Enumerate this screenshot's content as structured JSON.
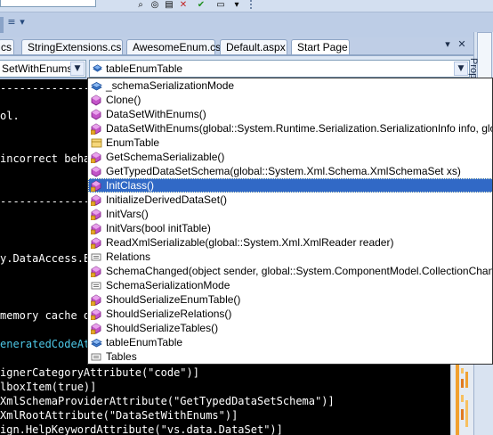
{
  "toolbar": {
    "icons": [
      "search-icon",
      "binoculars-icon",
      "properties-icon",
      "close-icon",
      "check-icon",
      "window-icon"
    ],
    "dropdown_glyph": "▾",
    "grip_glyph": "⁞"
  },
  "tabs": [
    {
      "label": "cs"
    },
    {
      "label": "StringExtensions.cs"
    },
    {
      "label": "AwesomeEnum.cs"
    },
    {
      "label": "Default.aspx"
    },
    {
      "label": "Start Page"
    }
  ],
  "tab_controls": {
    "dropdown": "▾",
    "close": "✕"
  },
  "navigation": {
    "type_combo_value": "SetWithEnums",
    "member_combo_value": "tableEnumTable",
    "arrow": "▼"
  },
  "side_panel": {
    "label": "Prop"
  },
  "code_lines": [
    {
      "text": "---------------",
      "color": "#ffffff"
    },
    {
      "text": "ol.",
      "color": "#ffffff"
    },
    {
      "text": "incorrect beha",
      "color": "#ffffff"
    },
    {
      "text": "---------------",
      "color": "#ffffff"
    },
    {
      "text": "y.DataAccess.E",
      "color": "#ffffff"
    },
    {
      "text": "memory cache o",
      "color": "#ffffff"
    },
    {
      "text": "eneratedCodeAt",
      "color": "#4ec9e8"
    },
    {
      "text": "ignerCategoryAttribute(\"code\")]",
      "color": "#ffffff"
    },
    {
      "text": "lboxItem(true)]",
      "color": "#ffffff"
    },
    {
      "text": "XmlSchemaProviderAttribute(\"GetTypedDataSetSchema\")]",
      "color": "#ffffff"
    },
    {
      "text": "XmlRootAttribute(\"DataSetWithEnums\")]",
      "color": "#ffffff"
    },
    {
      "text": "ign.HelpKeywordAttribute(\"vs.data.DataSet\")]",
      "color": "#ffffff"
    }
  ],
  "completion_list": {
    "selected_index": 7,
    "items": [
      {
        "label": "_schemaSerializationMode",
        "icon": "field-icon"
      },
      {
        "label": "Clone()",
        "icon": "method-icon"
      },
      {
        "label": "DataSetWithEnums()",
        "icon": "method-icon"
      },
      {
        "label": "DataSetWithEnums(global::System.Runtime.Serialization.SerializationInfo info, global::Sys",
        "icon": "protected-method-icon"
      },
      {
        "label": "EnumTable",
        "icon": "class-icon"
      },
      {
        "label": "GetSchemaSerializable()",
        "icon": "protected-method-icon"
      },
      {
        "label": "GetTypedDataSetSchema(global::System.Xml.Schema.XmlSchemaSet xs)",
        "icon": "method-icon"
      },
      {
        "label": "InitClass()",
        "icon": "private-method-icon"
      },
      {
        "label": "InitializeDerivedDataSet()",
        "icon": "protected-method-icon"
      },
      {
        "label": "InitVars()",
        "icon": "internal-method-icon"
      },
      {
        "label": "InitVars(bool initTable)",
        "icon": "internal-method-icon"
      },
      {
        "label": "ReadXmlSerializable(global::System.Xml.XmlReader reader)",
        "icon": "protected-method-icon"
      },
      {
        "label": "Relations",
        "icon": "property-icon"
      },
      {
        "label": "SchemaChanged(object sender, global::System.ComponentModel.CollectionChangeEventA",
        "icon": "private-method-icon"
      },
      {
        "label": "SchemaSerializationMode",
        "icon": "property-icon"
      },
      {
        "label": "ShouldSerializeEnumTable()",
        "icon": "private-method-icon"
      },
      {
        "label": "ShouldSerializeRelations()",
        "icon": "protected-method-icon"
      },
      {
        "label": "ShouldSerializeTables()",
        "icon": "protected-method-icon"
      },
      {
        "label": "tableEnumTable",
        "icon": "field-icon"
      },
      {
        "label": "Tables",
        "icon": "property-icon"
      }
    ]
  },
  "colors": {
    "selection": "#3169c6",
    "method": "#c354c8",
    "field": "#3f7ccf",
    "property": "#6a6a6a",
    "lock": "#e4a726",
    "code_background": "#000000"
  }
}
